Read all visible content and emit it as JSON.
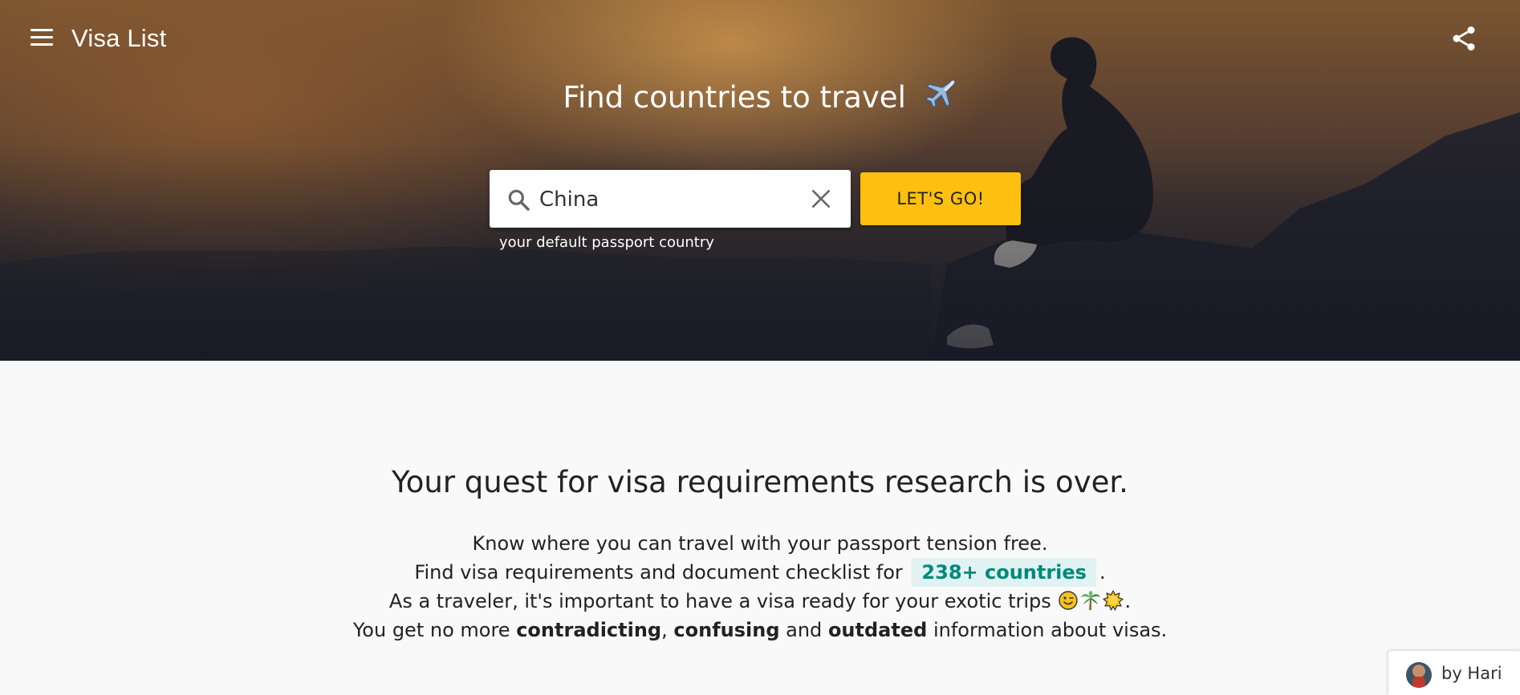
{
  "header": {
    "app_title": "Visa List",
    "menu_icon": "hamburger-menu-icon",
    "share_icon": "share-icon"
  },
  "hero": {
    "title": "Find countries to travel",
    "title_icon": "airplane-icon",
    "search": {
      "value": "China",
      "placeholder": "",
      "helper_text": "your default passport country"
    },
    "go_button_label": "LET'S GO!"
  },
  "intro": {
    "headline": "Your quest for visa requirements research is over.",
    "line1": "Know where you can travel with your passport tension free.",
    "line2_prefix": "Find visa requirements and document checklist for",
    "line2_highlight": "238+ countries",
    "line2_suffix": ".",
    "line3_prefix": "As a traveler, it's important to have a visa ready for your exotic trips",
    "line3_icons": [
      "winking-face-icon",
      "palm-tree-icon",
      "sun-icon"
    ],
    "line3_suffix": ".",
    "line4_prefix": "You get no more",
    "line4_bold1": "contradicting",
    "line4_sep1": ",",
    "line4_bold2": "confusing",
    "line4_mid": "and",
    "line4_bold3": "outdated",
    "line4_suffix": "information about visas."
  },
  "author_badge": {
    "label": "by Hari"
  },
  "colors": {
    "accent_yellow": "#fdbf10",
    "highlight_teal": "#00897b",
    "highlight_bg": "#e0f2f1"
  }
}
